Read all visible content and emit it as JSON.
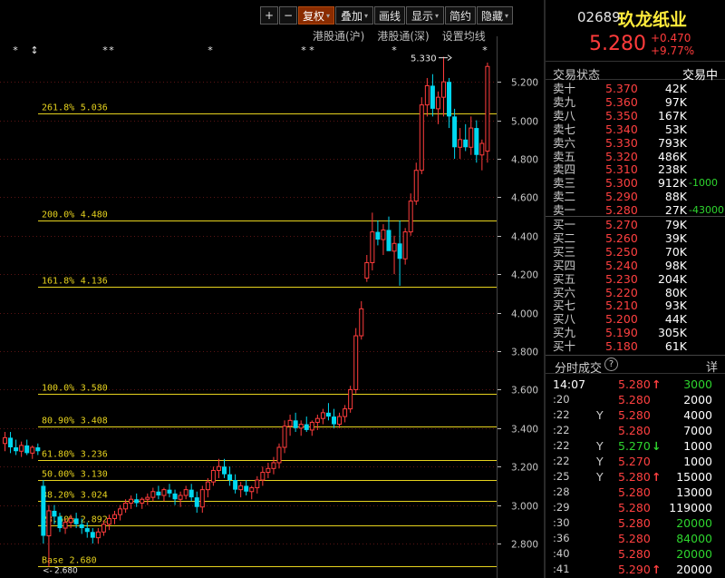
{
  "toolbar": {
    "buttons": [
      {
        "label": "+",
        "w": 20
      },
      {
        "label": "−",
        "w": 20
      },
      {
        "label": "复权",
        "w": 40,
        "caret": true,
        "active": true
      },
      {
        "label": "叠加",
        "w": 42,
        "caret": true
      },
      {
        "label": "画线",
        "w": 34
      },
      {
        "label": "显示",
        "w": 42,
        "caret": true
      },
      {
        "label": "简约",
        "w": 34
      },
      {
        "label": "隐藏",
        "w": 40,
        "caret": true
      }
    ]
  },
  "subbar": [
    "港股通(沪)",
    "港股通(深)",
    "设置均线"
  ],
  "chart_data": {
    "type": "candlestick",
    "title": "",
    "ylim": [
      2.62,
      5.36
    ],
    "yticks": [
      2.8,
      3.0,
      3.2,
      3.4,
      3.6,
      3.8,
      4.0,
      4.2,
      4.4,
      4.6,
      4.8,
      5.0,
      5.2
    ],
    "ytick_labels": [
      "2.800",
      "3.000",
      "3.200",
      "3.400",
      "3.600",
      "3.800",
      "4.000",
      "4.200",
      "4.400",
      "4.600",
      "4.800",
      "5.000",
      "5.200"
    ],
    "fib_levels": [
      {
        "label": "261.8%",
        "value": "5.036"
      },
      {
        "label": "200.0%",
        "value": "4.480"
      },
      {
        "label": "161.8%",
        "value": "4.136"
      },
      {
        "label": "100.0%",
        "value": "3.580"
      },
      {
        "label": "80.90%",
        "value": "3.408"
      },
      {
        "label": "61.80%",
        "value": "3.236"
      },
      {
        "label": "50.00%",
        "value": "3.130"
      },
      {
        "label": "38.20%",
        "value": "3.024"
      },
      {
        "label": "23.60%",
        "value": "2.892"
      },
      {
        "label": "Base",
        "value": "2.680"
      }
    ],
    "high_annotation": "5.330",
    "low_annotation": "2.680",
    "candles": [
      [
        3.32,
        3.38,
        3.28,
        3.35
      ],
      [
        3.35,
        3.38,
        3.27,
        3.3
      ],
      [
        3.3,
        3.34,
        3.26,
        3.28
      ],
      [
        3.28,
        3.33,
        3.25,
        3.31
      ],
      [
        3.31,
        3.34,
        3.26,
        3.27
      ],
      [
        3.27,
        3.31,
        3.24,
        3.3
      ],
      [
        3.3,
        3.32,
        3.26,
        3.28
      ],
      [
        3.1,
        3.13,
        2.8,
        2.84
      ],
      [
        2.84,
        3.0,
        2.68,
        2.97
      ],
      [
        2.97,
        3.0,
        2.9,
        2.94
      ],
      [
        2.94,
        2.96,
        2.86,
        2.88
      ],
      [
        2.88,
        2.93,
        2.85,
        2.91
      ],
      [
        2.91,
        2.95,
        2.88,
        2.93
      ],
      [
        2.93,
        2.96,
        2.88,
        2.9
      ],
      [
        2.9,
        2.93,
        2.85,
        2.88
      ],
      [
        2.88,
        2.91,
        2.83,
        2.86
      ],
      [
        2.86,
        2.88,
        2.8,
        2.83
      ],
      [
        2.83,
        2.88,
        2.8,
        2.86
      ],
      [
        2.86,
        2.92,
        2.84,
        2.9
      ],
      [
        2.9,
        2.95,
        2.87,
        2.93
      ],
      [
        2.93,
        2.97,
        2.9,
        2.95
      ],
      [
        2.95,
        3.0,
        2.92,
        2.98
      ],
      [
        2.98,
        3.03,
        2.96,
        3.01
      ],
      [
        3.01,
        3.05,
        2.98,
        3.03
      ],
      [
        3.03,
        3.06,
        2.99,
        3.01
      ],
      [
        3.01,
        3.04,
        2.98,
        3.03
      ],
      [
        3.03,
        3.06,
        3.0,
        3.04
      ],
      [
        3.04,
        3.09,
        3.02,
        3.07
      ],
      [
        3.07,
        3.1,
        3.03,
        3.05
      ],
      [
        3.05,
        3.09,
        3.02,
        3.08
      ],
      [
        3.08,
        3.11,
        3.04,
        3.06
      ],
      [
        3.06,
        3.08,
        3.0,
        3.03
      ],
      [
        3.03,
        3.07,
        2.99,
        3.05
      ],
      [
        3.05,
        3.1,
        3.03,
        3.08
      ],
      [
        3.08,
        3.11,
        3.02,
        3.04
      ],
      [
        3.04,
        3.07,
        2.96,
        2.99
      ],
      [
        2.99,
        3.1,
        2.96,
        3.08
      ],
      [
        3.08,
        3.14,
        3.04,
        3.12
      ],
      [
        3.12,
        3.2,
        3.1,
        3.18
      ],
      [
        3.18,
        3.24,
        3.14,
        3.2
      ],
      [
        3.2,
        3.24,
        3.14,
        3.16
      ],
      [
        3.16,
        3.2,
        3.1,
        3.13
      ],
      [
        3.13,
        3.16,
        3.06,
        3.08
      ],
      [
        3.08,
        3.12,
        3.04,
        3.1
      ],
      [
        3.1,
        3.13,
        3.05,
        3.07
      ],
      [
        3.07,
        3.1,
        3.03,
        3.09
      ],
      [
        3.09,
        3.15,
        3.06,
        3.13
      ],
      [
        3.13,
        3.2,
        3.1,
        3.17
      ],
      [
        3.17,
        3.22,
        3.14,
        3.19
      ],
      [
        3.19,
        3.25,
        3.16,
        3.22
      ],
      [
        3.22,
        3.32,
        3.19,
        3.3
      ],
      [
        3.3,
        3.44,
        3.27,
        3.41
      ],
      [
        3.41,
        3.47,
        3.36,
        3.44
      ],
      [
        3.44,
        3.48,
        3.38,
        3.4
      ],
      [
        3.4,
        3.44,
        3.36,
        3.42
      ],
      [
        3.42,
        3.46,
        3.38,
        3.39
      ],
      [
        3.39,
        3.44,
        3.36,
        3.43
      ],
      [
        3.43,
        3.47,
        3.39,
        3.45
      ],
      [
        3.45,
        3.5,
        3.42,
        3.48
      ],
      [
        3.48,
        3.53,
        3.44,
        3.46
      ],
      [
        3.46,
        3.5,
        3.4,
        3.42
      ],
      [
        3.42,
        3.48,
        3.4,
        3.46
      ],
      [
        3.46,
        3.52,
        3.43,
        3.5
      ],
      [
        3.5,
        3.62,
        3.48,
        3.6
      ],
      [
        3.6,
        3.92,
        3.58,
        3.88
      ],
      [
        3.88,
        4.06,
        3.86,
        4.02
      ],
      [
        4.18,
        4.3,
        4.16,
        4.26
      ],
      [
        4.26,
        4.52,
        4.22,
        4.42
      ],
      [
        4.42,
        4.48,
        4.35,
        4.38
      ],
      [
        4.38,
        4.46,
        4.3,
        4.43
      ],
      [
        4.43,
        4.5,
        4.38,
        4.32
      ],
      [
        4.32,
        4.4,
        4.2,
        4.36
      ],
      [
        4.36,
        4.48,
        4.14,
        4.28
      ],
      [
        4.28,
        4.44,
        4.25,
        4.42
      ],
      [
        4.42,
        4.62,
        4.4,
        4.58
      ],
      [
        4.58,
        4.78,
        4.56,
        4.74
      ],
      [
        4.74,
        5.12,
        4.72,
        5.08
      ],
      [
        5.08,
        5.22,
        5.02,
        5.18
      ],
      [
        5.18,
        5.24,
        5.02,
        5.06
      ],
      [
        5.06,
        5.15,
        4.98,
        5.12
      ],
      [
        5.12,
        5.33,
        5.02,
        5.2
      ],
      [
        5.2,
        5.22,
        4.96,
        5.02
      ],
      [
        5.02,
        5.06,
        4.8,
        4.86
      ],
      [
        4.86,
        4.96,
        4.8,
        4.9
      ],
      [
        4.9,
        4.98,
        4.84,
        4.86
      ],
      [
        4.86,
        5.02,
        4.82,
        4.96
      ],
      [
        4.96,
        5.0,
        4.78,
        4.82
      ],
      [
        4.82,
        4.9,
        4.74,
        4.88
      ],
      [
        4.84,
        5.3,
        4.78,
        5.28
      ]
    ]
  },
  "stock": {
    "code": "02689",
    "name": "玖龙纸业",
    "price": "5.280",
    "change": "+0.470",
    "change_pct": "+9.77%",
    "state_label": "交易状态",
    "state_value": "交易中"
  },
  "orderbook": {
    "asks": [
      {
        "label": "卖十",
        "price": "5.370",
        "vol": "42K",
        "chg": ""
      },
      {
        "label": "卖九",
        "price": "5.360",
        "vol": "97K",
        "chg": ""
      },
      {
        "label": "卖八",
        "price": "5.350",
        "vol": "167K",
        "chg": ""
      },
      {
        "label": "卖七",
        "price": "5.340",
        "vol": "53K",
        "chg": ""
      },
      {
        "label": "卖六",
        "price": "5.330",
        "vol": "793K",
        "chg": ""
      },
      {
        "label": "卖五",
        "price": "5.320",
        "vol": "486K",
        "chg": ""
      },
      {
        "label": "卖四",
        "price": "5.310",
        "vol": "238K",
        "chg": ""
      },
      {
        "label": "卖三",
        "price": "5.300",
        "vol": "912K",
        "chg": "-1000"
      },
      {
        "label": "卖二",
        "price": "5.290",
        "vol": "88K",
        "chg": ""
      },
      {
        "label": "卖一",
        "price": "5.280",
        "vol": "27K",
        "chg": "-43000"
      }
    ],
    "bids": [
      {
        "label": "买一",
        "price": "5.270",
        "vol": "79K",
        "chg": ""
      },
      {
        "label": "买二",
        "price": "5.260",
        "vol": "39K",
        "chg": ""
      },
      {
        "label": "买三",
        "price": "5.250",
        "vol": "70K",
        "chg": ""
      },
      {
        "label": "买四",
        "price": "5.240",
        "vol": "98K",
        "chg": ""
      },
      {
        "label": "买五",
        "price": "5.230",
        "vol": "204K",
        "chg": ""
      },
      {
        "label": "买六",
        "price": "5.220",
        "vol": "80K",
        "chg": ""
      },
      {
        "label": "买七",
        "price": "5.210",
        "vol": "93K",
        "chg": ""
      },
      {
        "label": "买八",
        "price": "5.200",
        "vol": "44K",
        "chg": ""
      },
      {
        "label": "买九",
        "price": "5.190",
        "vol": "305K",
        "chg": ""
      },
      {
        "label": "买十",
        "price": "5.180",
        "vol": "61K",
        "chg": ""
      }
    ]
  },
  "trades": {
    "title": "分时成交",
    "info": "?",
    "detail": "详",
    "rows": [
      {
        "time": "14:07",
        "y": "",
        "price": "5.280",
        "dir": "up",
        "vol": "3000",
        "vcolor": "g"
      },
      {
        "time": ":20",
        "y": "",
        "price": "5.280",
        "dir": "",
        "vol": "2000",
        "vcolor": "w"
      },
      {
        "time": ":22",
        "y": "Y",
        "price": "5.280",
        "dir": "",
        "vol": "4000",
        "vcolor": "w"
      },
      {
        "time": ":22",
        "y": "",
        "price": "5.280",
        "dir": "",
        "vol": "7000",
        "vcolor": "w"
      },
      {
        "time": ":22",
        "y": "Y",
        "price": "5.270",
        "dir": "down",
        "vol": "1000",
        "vcolor": "w"
      },
      {
        "time": ":22",
        "y": "Y",
        "price": "5.270",
        "dir": "",
        "vol": "1000",
        "vcolor": "w"
      },
      {
        "time": ":25",
        "y": "Y",
        "price": "5.280",
        "dir": "up",
        "vol": "15000",
        "vcolor": "w"
      },
      {
        "time": ":28",
        "y": "",
        "price": "5.280",
        "dir": "",
        "vol": "13000",
        "vcolor": "w"
      },
      {
        "time": ":29",
        "y": "",
        "price": "5.280",
        "dir": "",
        "vol": "119000",
        "vcolor": "w"
      },
      {
        "time": ":30",
        "y": "",
        "price": "5.280",
        "dir": "",
        "vol": "20000",
        "vcolor": "g"
      },
      {
        "time": ":36",
        "y": "",
        "price": "5.280",
        "dir": "",
        "vol": "84000",
        "vcolor": "g"
      },
      {
        "time": ":40",
        "y": "",
        "price": "5.280",
        "dir": "",
        "vol": "20000",
        "vcolor": "g"
      },
      {
        "time": ":41",
        "y": "",
        "price": "5.290",
        "dir": "up",
        "vol": "20000",
        "vcolor": "w"
      }
    ]
  }
}
